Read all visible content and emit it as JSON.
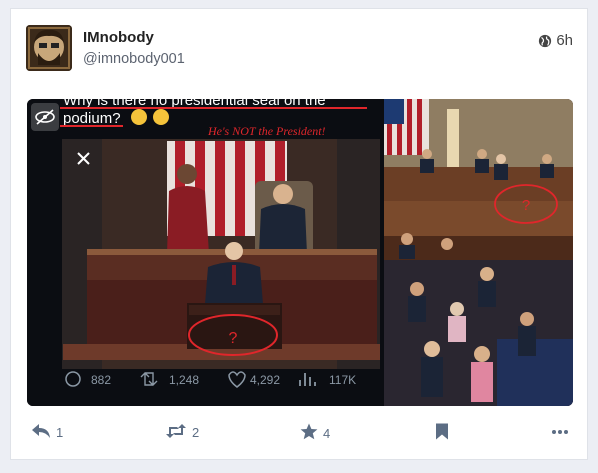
{
  "post": {
    "display_name": "IMnobody",
    "handle": "@imnobody001",
    "time": "6h"
  },
  "media": {
    "caption_line1": "Why is there no presidential seal on the",
    "caption_line2": "podium?",
    "handwritten_note": "He's NOT the President!",
    "question_mark_left": "?",
    "question_mark_right": "?",
    "tweet_stats": {
      "replies": "882",
      "retweets": "1,248",
      "likes": "4,292",
      "views": "117K"
    }
  },
  "actions": {
    "reply_count": "1",
    "boost_count": "2",
    "favourite_count": "4"
  },
  "colors": {
    "annotation_red": "#e0262b",
    "icon_gray": "#5c6d84",
    "card_bg": "#ffffff",
    "page_bg": "#eceef4"
  }
}
